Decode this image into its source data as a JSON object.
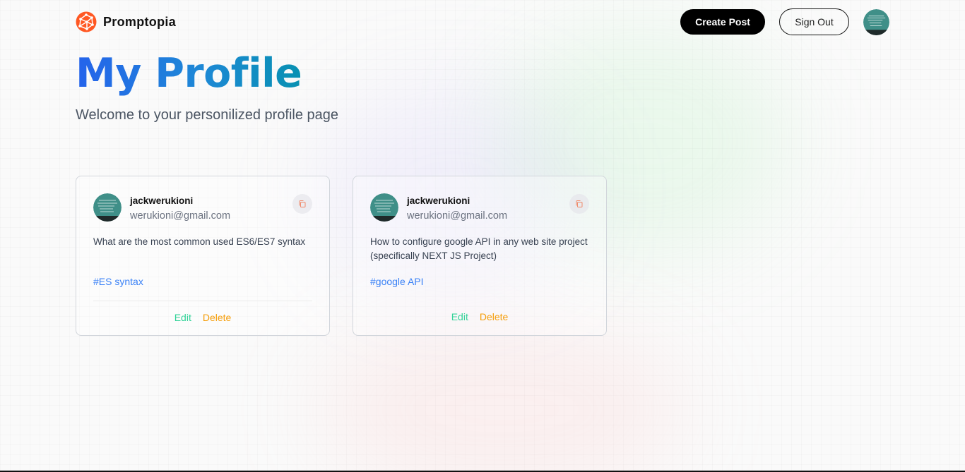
{
  "header": {
    "brand": "Promptopia",
    "create_post_label": "Create Post",
    "sign_out_label": "Sign Out"
  },
  "page": {
    "title": "My Profile",
    "subtitle": "Welcome to your personilized profile page"
  },
  "colors": {
    "accent_blue": "#2563eb",
    "accent_cyan": "#0891b2",
    "tag_blue": "#3b82f6",
    "edit_green": "#34d399",
    "delete_orange": "#f59e0b",
    "logo_orange": "#ff5722"
  },
  "icons": {
    "logo": "network-globe-icon",
    "copy": "copy-icon"
  },
  "posts": [
    {
      "username": "jackwerukioni",
      "email": "werukioni@gmail.com",
      "prompt": "What are the most common used ES6/ES7 syntax",
      "tag": "#ES syntax",
      "edit_label": "Edit",
      "delete_label": "Delete"
    },
    {
      "username": "jackwerukioni",
      "email": "werukioni@gmail.com",
      "prompt": "How to configure google API in any web site project (specifically NEXT JS Project)",
      "tag": "#google API",
      "edit_label": "Edit",
      "delete_label": "Delete"
    }
  ]
}
